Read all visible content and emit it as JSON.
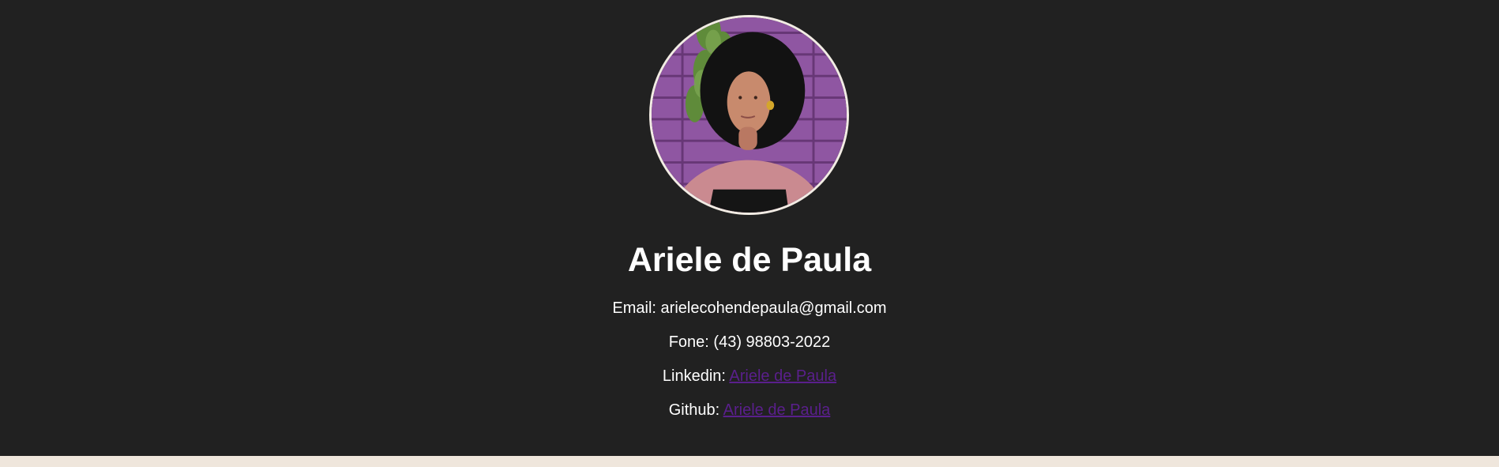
{
  "profile": {
    "name": "Ariele de Paula",
    "photo_icon": "profile-photo"
  },
  "contact": {
    "email_label": "Email:",
    "email_value": "arielecohendepaula@gmail.com",
    "phone_label": "Fone:",
    "phone_value": "(43) 98803-2022",
    "linkedin_label": "Linkedin:",
    "linkedin_link_text": "Ariele de Paula",
    "github_label": "Github:",
    "github_link_text": "Ariele de Paula"
  },
  "colors": {
    "header_background": "#212121",
    "page_background": "#efe6dc",
    "text": "#ffffff",
    "link": "#5a1f8c",
    "avatar_border": "#f2ece4"
  }
}
